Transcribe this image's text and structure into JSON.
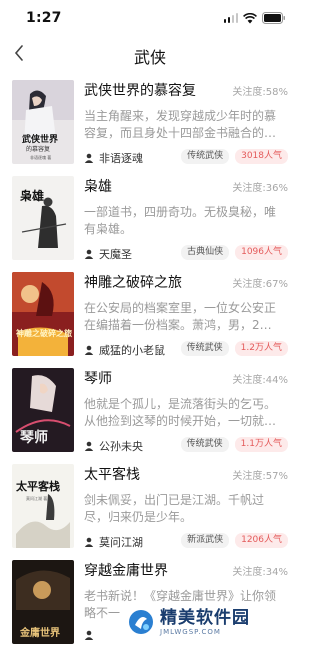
{
  "status": {
    "time": "1:27"
  },
  "header": {
    "title": "武侠"
  },
  "books": [
    {
      "title": "武侠世界的慕容复",
      "attention": "关注度:58%",
      "desc": "当主角醒来，发现穿越成少年时的慕容复，而且身处十四部金书融合的大武…",
      "author": "非语逐魂",
      "genre": "传统武侠",
      "popularity": "3018人气",
      "cover_title": "武侠世界",
      "cover_sub": "的慕容复",
      "cover_author": "非语逐魂 著"
    },
    {
      "title": "枭雄",
      "attention": "关注度:36%",
      "desc": "一部道书，四册奇功。无极臭秘，唯有枭雄。",
      "author": "天魔圣",
      "genre": "古典仙侠",
      "popularity": "1096人气",
      "cover_title": "枭雄"
    },
    {
      "title": "神雕之破碎之旅",
      "attention": "关注度:67%",
      "desc": "在公安局的档案室里，一位女公安正在编描着一份档案。萧鸿，男，26岁，…",
      "author": "威猛的小老鼠",
      "genre": "传统武侠",
      "popularity": "1.2万人气",
      "cover_title": "神雕之破碎之旅"
    },
    {
      "title": "琴师",
      "attention": "关注度:44%",
      "desc": "他就是个孤儿，是流落街头的乞丐。从他捡到这琴的时候开始，一切就变得…",
      "author": "公孙未央",
      "genre": "传统武侠",
      "popularity": "1.1万人气",
      "cover_title": "琴师"
    },
    {
      "title": "太平客栈",
      "attention": "关注度:57%",
      "desc": "剑未佩妥，出门已是江湖。千帆过尽，归来仍是少年。",
      "author": "莫问江湖",
      "genre": "新派武侠",
      "popularity": "1206人气",
      "cover_title": "太平客栈",
      "cover_sub": "莫问江湖 著"
    },
    {
      "title": "穿越金庸世界",
      "attention": "关注度:34%",
      "desc": "老书新说！《穿越金庸世界》让你领略不一",
      "author": "",
      "genre": "",
      "popularity": "",
      "cover_title": "金庸世界"
    }
  ],
  "watermark": {
    "title": "精美软件园",
    "url": "JMLWGSP.COM"
  },
  "icons": {
    "back": "chevron-left-icon",
    "author": "person-icon",
    "signal": "signal-icon",
    "wifi": "wifi-icon",
    "battery": "battery-icon"
  },
  "colors": {
    "popularity_text": "#e45b5b",
    "popularity_bg": "#fdeaea",
    "tag_bg": "#f2f2f2",
    "muted": "#9a9a9a"
  }
}
